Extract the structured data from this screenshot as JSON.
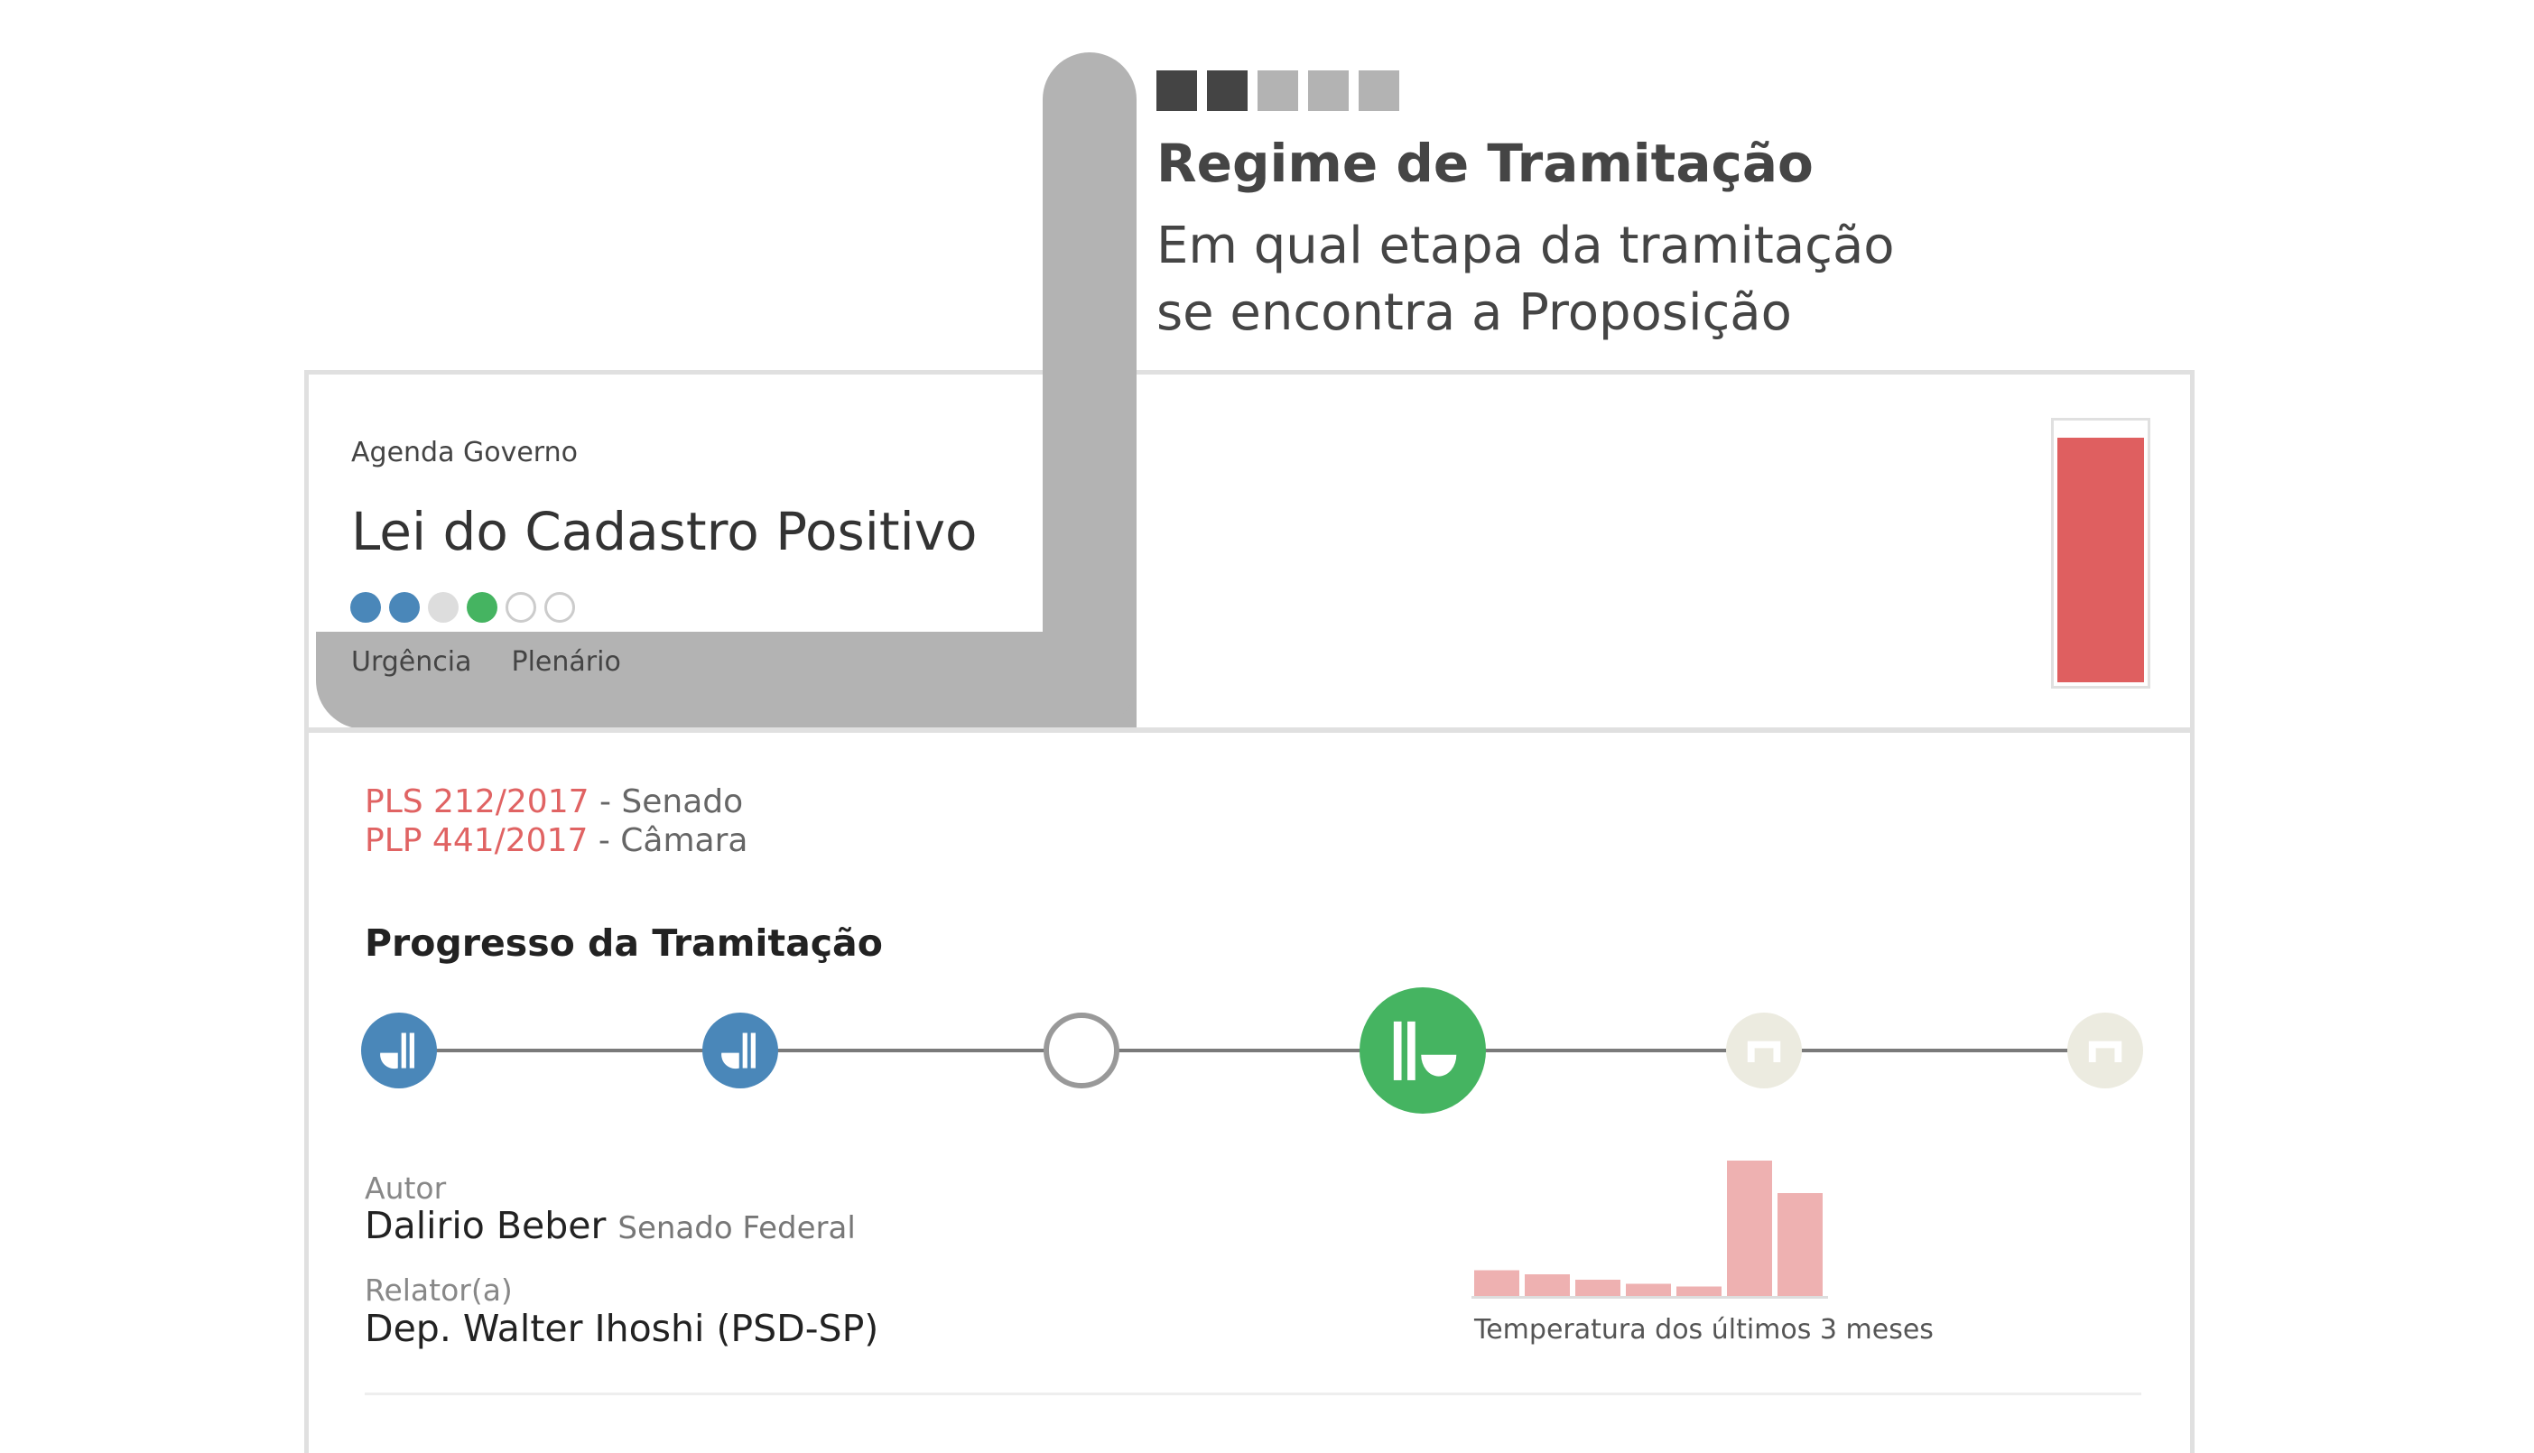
{
  "annotation": {
    "squares": [
      {
        "color": "#444444"
      },
      {
        "color": "#444444"
      },
      {
        "color": "#b3b3b3"
      },
      {
        "color": "#b3b3b3"
      },
      {
        "color": "#b3b3b3"
      }
    ],
    "title": "Regime de Tramitação",
    "description_lines": [
      "Em qual etapa da tramitação",
      "se encontra a Proposição"
    ]
  },
  "card": {
    "agenda_label": "Agenda Governo",
    "title": "Lei do Cadastro Positivo",
    "stage_dots": [
      {
        "state": "filled",
        "color": "#4a87b9"
      },
      {
        "state": "filled",
        "color": "#4a87b9"
      },
      {
        "state": "filled",
        "color": "#dddddd"
      },
      {
        "state": "filled",
        "color": "#45b461"
      },
      {
        "state": "empty",
        "color": "#cccccc"
      },
      {
        "state": "empty",
        "color": "#cccccc"
      }
    ],
    "dot_labels": [
      "Urgência",
      "Plenário"
    ],
    "temperature_level": 0.95,
    "temperature_color": "#df5f60"
  },
  "propositions": [
    {
      "code": "PLS 212/2017",
      "house": " - Senado"
    },
    {
      "code": "PLP 441/2017",
      "house": " - Câmara"
    }
  ],
  "progress": {
    "title": "Progresso da Tramitação",
    "steps": [
      {
        "state": "done",
        "icon": "plenary-icon",
        "color": "#4a87b9"
      },
      {
        "state": "done",
        "icon": "plenary-icon",
        "color": "#4a87b9"
      },
      {
        "state": "skipped",
        "icon": "empty-circle-icon",
        "color": "#999999"
      },
      {
        "state": "current",
        "icon": "plenary-icon",
        "color": "#45b461"
      },
      {
        "state": "future",
        "icon": "committee-icon",
        "color": "#ecebe0"
      },
      {
        "state": "future",
        "icon": "committee-icon",
        "color": "#ecebe0"
      }
    ]
  },
  "author": {
    "label": "Autor",
    "name": "Dalirio Beber",
    "org": "Senado Federal"
  },
  "rapporteur": {
    "label": "Relator(a)",
    "name": "Dep. Walter Ihoshi (PSD-SP)"
  },
  "temperature": {
    "caption": "Temperatura dos últimos 3 meses",
    "bar_color": "#eeb1b1",
    "values": [
      19,
      16,
      12,
      9,
      7,
      100,
      76
    ]
  }
}
